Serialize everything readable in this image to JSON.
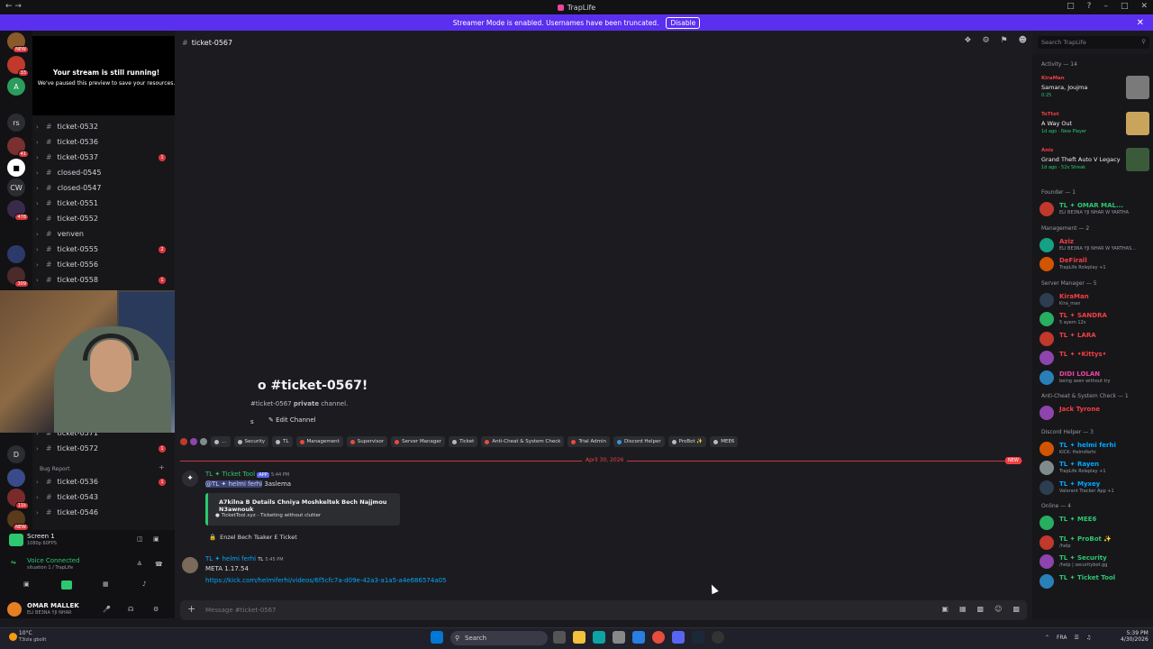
{
  "titlebar": {
    "title": "TrapLife"
  },
  "streamer_banner": {
    "text": "Streamer Mode is enabled. Usernames have been truncated.",
    "disable_label": "Disable"
  },
  "stream_preview": {
    "title": "Your stream is still running!",
    "subtitle": "We've paused this preview to save your resources."
  },
  "guild_badges": [
    "NEW",
    "33",
    "rs",
    "41",
    "CW",
    "478",
    "309",
    "D",
    "11k",
    "NEW"
  ],
  "channels": [
    {
      "name": "ticket-0532",
      "unread": ""
    },
    {
      "name": "ticket-0536",
      "unread": ""
    },
    {
      "name": "ticket-0537",
      "unread": "1"
    },
    {
      "name": "closed-0545",
      "unread": ""
    },
    {
      "name": "closed-0547",
      "unread": ""
    },
    {
      "name": "ticket-0551",
      "unread": ""
    },
    {
      "name": "ticket-0552",
      "unread": ""
    },
    {
      "name": "venven",
      "unread": ""
    },
    {
      "name": "ticket-0555",
      "unread": "2"
    },
    {
      "name": "ticket-0556",
      "unread": ""
    },
    {
      "name": "ticket-0558",
      "unread": "1"
    }
  ],
  "channels_lower": [
    {
      "name": "ticket-0571",
      "unread": ""
    },
    {
      "name": "ticket-0572",
      "unread": "1"
    }
  ],
  "bug_report": {
    "category": "Bug Report",
    "channels": [
      {
        "name": "ticket-0536",
        "unread": "1"
      },
      {
        "name": "ticket-0543",
        "unread": ""
      },
      {
        "name": "ticket-0546",
        "unread": ""
      }
    ]
  },
  "voice_panel": {
    "screen_label": "Screen 1",
    "screen_sub": "1080p 60FPS",
    "voice_status": "Voice Connected",
    "voice_sub": "situation 1 / TrapLife",
    "user_name": "OMAR MALLEK",
    "user_status": "ELI BE3NA YJI NHAR"
  },
  "channel_header": {
    "name": "ticket-0567",
    "search_placeholder": "Search TrapLife"
  },
  "welcome": {
    "title": "o #ticket-0567!",
    "subtitle_channel": "#ticket-0567",
    "subtitle_bold": "private",
    "subtitle_end": "channel.",
    "edit_channel": "Edit Channel",
    "edit_prefix": "s"
  },
  "roles": [
    {
      "name": "…",
      "color": "#b5bac1"
    },
    {
      "name": "Security",
      "color": "#b5bac1"
    },
    {
      "name": "TL",
      "color": "#b5bac1"
    },
    {
      "name": "Management",
      "color": "#e74c3c"
    },
    {
      "name": "Supervisor",
      "color": "#e74c3c"
    },
    {
      "name": "Server Manager",
      "color": "#e74c3c"
    },
    {
      "name": "Ticket",
      "color": "#b5bac1"
    },
    {
      "name": "Anti-Cheat & System Check",
      "color": "#e74c3c"
    },
    {
      "name": "Trial Admin",
      "color": "#e74c3c"
    },
    {
      "name": "Discord Helper",
      "color": "#3498db"
    },
    {
      "name": "ProBot ✨",
      "color": "#b5bac1"
    },
    {
      "name": "MEE6",
      "color": "#b5bac1"
    }
  ],
  "divider": {
    "date": "April 30, 2026",
    "new_label": "NEW"
  },
  "message1": {
    "author": "TL ✦ Ticket Tool",
    "app_badge": "APP",
    "time": "5:44 PM",
    "mention": "@TL ✦ helmi ferhi",
    "text": "3aslema",
    "embed_title": "A7kilna B Details Chniya Moshkeltek Bech Najjmou N3awnouk",
    "embed_footer": "TicketTool.xyz - Ticketing without clutter",
    "button": "Enzel Bech Tsaker E Ticket"
  },
  "message2": {
    "author": "TL ✦ helmi ferhi",
    "tag": "TL",
    "time": "5:45 PM",
    "text": "META 1.17.54",
    "link": "https://kick.com/helmiferhi/videos/6f5cfc7a-d09e-42a3-a1a5-a4e686574a05"
  },
  "composer": {
    "placeholder": "Message #ticket-0567"
  },
  "members": {
    "activity_header": "Activity — 14",
    "activities": [
      {
        "name": "KiraMan",
        "title": "Samara, Joujma",
        "sub": "0:25",
        "color": "#f23f43"
      },
      {
        "name": "ToTtot",
        "title": "A Way Out",
        "sub": "1d ago · New Player",
        "color": "#f23f43"
      },
      {
        "name": "Anis",
        "title": "Grand Theft Auto V Legacy",
        "sub": "1d ago · 52x Streak",
        "color": "#f23f43"
      }
    ],
    "groups": [
      {
        "header": "Founder — 1",
        "members": [
          {
            "name": "TL ✦ OMAR MAL...",
            "sub": "ELI BE3NA YJI NHAR W YARTHA",
            "color": "#2dc770"
          }
        ]
      },
      {
        "header": "Management — 2",
        "members": [
          {
            "name": "Aziz",
            "sub": "ELI BE3NA YJI NHAR W YARTHAS...",
            "color": "#f23f43"
          },
          {
            "name": "DeFirall",
            "sub": "TrapLife Roleplay +1",
            "color": "#f23f43"
          }
        ]
      },
      {
        "header": "Server Manager — 5",
        "members": [
          {
            "name": "KiraMan",
            "sub": "Kira_man",
            "color": "#f23f43"
          },
          {
            "name": "TL ✦ SANDRA",
            "sub": "5 ayem 12s",
            "color": "#f23f43"
          },
          {
            "name": "TL ✦ LARA",
            "sub": "",
            "color": "#f23f43"
          },
          {
            "name": "TL ✦ •Kittys•",
            "sub": "",
            "color": "#f23f43"
          },
          {
            "name": "DIDI LOLAN",
            "sub": "being seen without try",
            "color": "#eb459e"
          }
        ]
      },
      {
        "header": "Anti-Cheat & System Check — 1",
        "members": [
          {
            "name": "Jack Tyrone",
            "sub": "",
            "color": "#f23f43"
          }
        ]
      },
      {
        "header": "Discord Helper — 3",
        "members": [
          {
            "name": "TL ✦ helmi ferhi",
            "sub": "KICK: Helmiferhi",
            "color": "#00a8fc"
          },
          {
            "name": "TL ✦ Rayen",
            "sub": "TrapLife Roleplay +1",
            "color": "#00a8fc"
          },
          {
            "name": "TL ✦ Myxey",
            "sub": "Valorant Tracker App +1",
            "color": "#00a8fc"
          }
        ]
      },
      {
        "header": "Online — 4",
        "members": [
          {
            "name": "TL ✦ MEE6",
            "sub": "",
            "color": "#2dc770"
          },
          {
            "name": "TL ✦ ProBot ✨",
            "sub": "/help",
            "color": "#2dc770"
          },
          {
            "name": "TL ✦ Security",
            "sub": "/help | securitybot.gg",
            "color": "#2dc770"
          },
          {
            "name": "TL ✦ Ticket Tool",
            "sub": "",
            "color": "#2dc770"
          }
        ]
      }
    ]
  },
  "taskbar": {
    "weather_temp": "10°C",
    "weather_desc": "T3izla gbolit",
    "search": "Search",
    "lang": "FRA",
    "time": "5:39 PM",
    "date": "4/30/2026"
  }
}
